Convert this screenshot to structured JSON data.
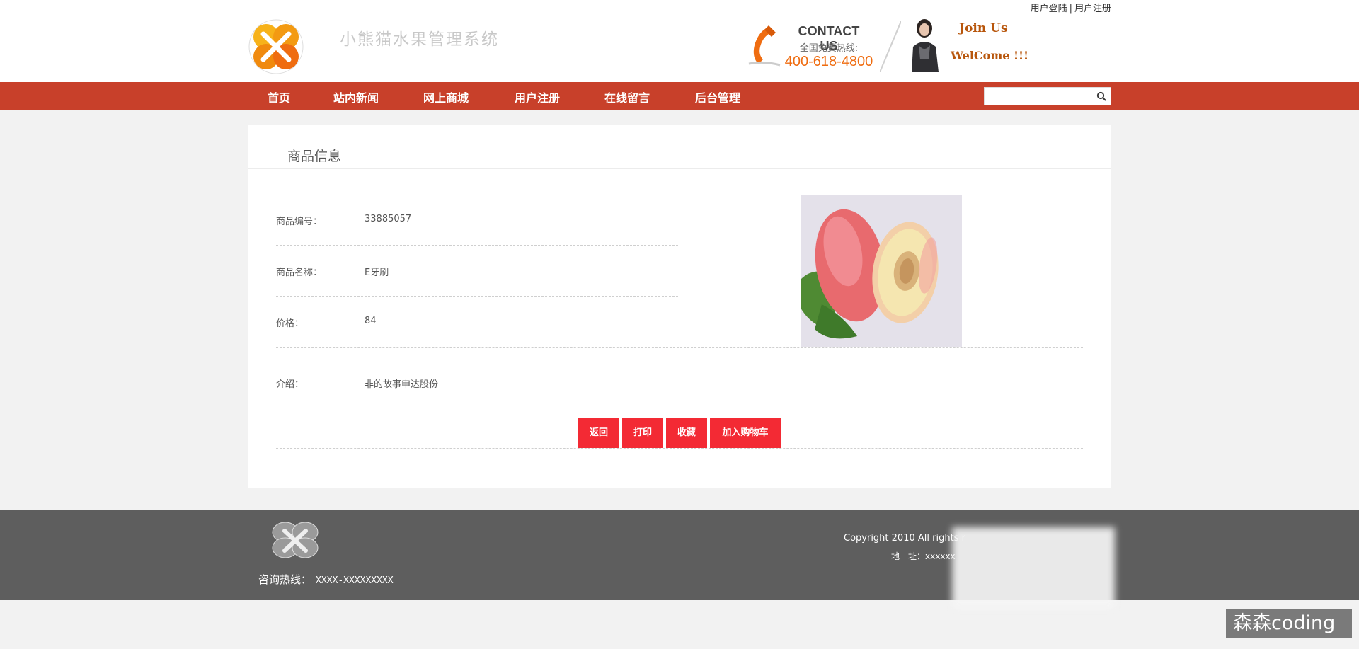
{
  "header": {
    "top_links": [
      "用户登陆",
      "用户注册"
    ],
    "top_links_separator": "|",
    "site_title": "小熊猫水果管理系统",
    "contact_title": "CONTACT US",
    "contact_sub": "全国免费热线:",
    "contact_number": "400-618-4800",
    "join_us": "Join Us",
    "welcome": "WelCome !!!"
  },
  "nav": {
    "items": [
      "首页",
      "站内新闻",
      "网上商城",
      "用户注册",
      "在线留言",
      "后台管理"
    ],
    "search_placeholder": ""
  },
  "product": {
    "panel_title": "商品信息",
    "id_label": "商品编号：",
    "id_value": "33885057",
    "name_label": "商品名称：",
    "name_value": "E牙刷",
    "price_label": "价格：",
    "price_value": "84",
    "intro_label": "介绍：",
    "intro_value": "非的故事申达股份"
  },
  "actions": {
    "back": "返回",
    "print": "打印",
    "favorite": "收藏",
    "add_to_cart": "加入购物车"
  },
  "footer": {
    "hotline_label": "咨询热线：",
    "hotline_number": "XXXX-XXXXXXXXX",
    "copyright": "Copyright 2010 All rights r",
    "address": "地　址：xxxxxx"
  },
  "watermark": "森森coding",
  "colors": {
    "nav_bg": "#c8402a",
    "button_bg": "#f32a34",
    "footer_bg": "#5e5e5e",
    "accent_orange": "#ef6c10"
  }
}
